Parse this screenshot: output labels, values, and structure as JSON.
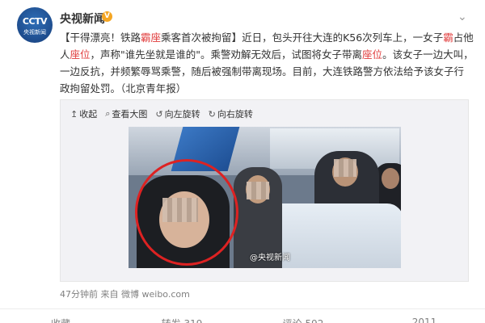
{
  "author": {
    "name": "央视新闻",
    "verified_mark": "V"
  },
  "post": {
    "tag_open": "【",
    "title_a": "干得漂亮！铁路",
    "title_hl": "霸座",
    "title_b": "乘客首次被拘留",
    "tag_close": "】",
    "body_a": "近日，包头开往大连的K56次列车上，一女子",
    "hl_1": "霸",
    "body_b": "占他人",
    "hl_2": "座位",
    "body_c": "，声称\"谁先坐就是谁的\"。乘警劝解无效后，试图将女子带离",
    "hl_3": "座位",
    "body_d": "。该女子一边大叫，一边反抗，并频繁辱骂乘警，随后被强制带离现场。目前，大连铁路警方依法给予该女子行政拘留处罚。（北京青年报）"
  },
  "toolbar": {
    "collapse": "收起",
    "view_large": "查看大图",
    "rotate_left": "向左旋转",
    "rotate_right": "向右旋转"
  },
  "photo": {
    "watermark": "@央视新闻"
  },
  "meta": {
    "time": "47分钟前",
    "source_prefix": "来自",
    "source": "微博 weibo.com"
  },
  "actions": {
    "favorite": "收藏",
    "repost": "转发 319",
    "comment": "评论 592",
    "like": "2011"
  },
  "colors": {
    "highlight": "#e03c3c",
    "avatar": "#1e4f94",
    "verified": "#f5a623",
    "circle": "#dd2222"
  }
}
